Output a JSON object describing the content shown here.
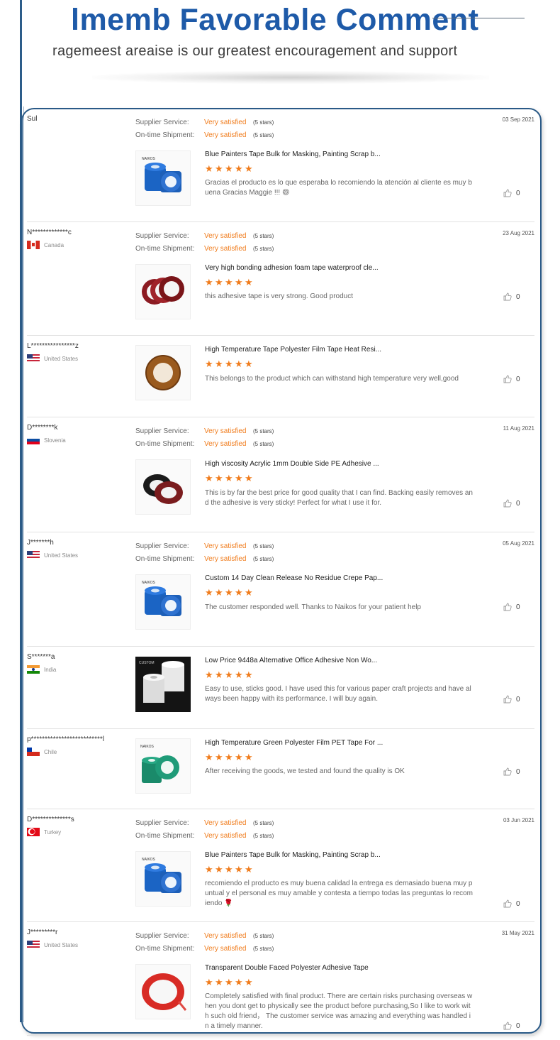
{
  "header": {
    "title": "lmemb Favorable Comment",
    "subtitle": "ragemeest areaise is our greatest encouragement and support"
  },
  "labels": {
    "supplier_service": "Supplier Service:",
    "shipment": "On-time Shipment:"
  },
  "reviews": [
    {
      "user": "Sul",
      "country": "",
      "date": "03 Sep 2021",
      "supplier_rating": "Very satisfied",
      "supplier_stars": "(5 stars)",
      "shipment_rating": "Very satisfied",
      "shipment_stars": "(5 stars)",
      "product": "Blue Painters Tape Bulk for Masking, Painting Scrap b...",
      "rating": 5,
      "comment": "Gracias el producto es lo que esperaba lo recomiendo la atención al cliente es muy buena Gracias Maggie !!! 😄",
      "likes": "0",
      "image": "blue-tape-icon"
    },
    {
      "user": "N*************c",
      "country": "Canada",
      "flag": "ca",
      "date": "23 Aug 2021",
      "supplier_rating": "Very satisfied",
      "supplier_stars": "(5 stars)",
      "shipment_rating": "Very satisfied",
      "shipment_stars": "(5 stars)",
      "product": "Very high bonding adhesion foam tape waterproof cle...",
      "rating": 5,
      "comment": "this adhesive tape is very strong. Good product",
      "likes": "0",
      "image": "red-tape-rolls-icon"
    },
    {
      "user": "L****************z",
      "country": "United States",
      "flag": "us",
      "date": "",
      "product": "High Temperature Tape Polyester Film Tape Heat Resi...",
      "rating": 5,
      "comment": "This belongs to the product which can withstand high temperature very well,good",
      "likes": "0",
      "image": "amber-tape-icon"
    },
    {
      "user": "D********k",
      "country": "Slovenia",
      "flag": "si",
      "date": "11 Aug 2021",
      "supplier_rating": "Very satisfied",
      "supplier_stars": "(5 stars)",
      "shipment_rating": "Very satisfied",
      "shipment_stars": "(5 stars)",
      "product": "High viscosity Acrylic 1mm Double Side PE Adhesive ...",
      "rating": 5,
      "comment": "This is by far the best price for good quality that I can find. Backing easily removes and the adhesive is very sticky! Perfect for what I use it for.",
      "likes": "0",
      "image": "black-foam-tape-icon"
    },
    {
      "user": "J*******h",
      "country": "United States",
      "flag": "us",
      "date": "05 Aug 2021",
      "supplier_rating": "Very satisfied",
      "supplier_stars": "(5 stars)",
      "shipment_rating": "Very satisfied",
      "shipment_stars": "(5 stars)",
      "product": "Custom 14 Day Clean Release No Residue Crepe Pap...",
      "rating": 5,
      "comment": "The customer responded well. Thanks to Naikos for your patient help",
      "likes": "0",
      "image": "blue-logo-tape-icon"
    },
    {
      "user": "S*******a",
      "country": "India",
      "flag": "in",
      "date": "",
      "product": "Low Price 9448a Alternative Office Adhesive Non Wo...",
      "rating": 5,
      "comment": "Easy to use, sticks good. I have used this for various paper craft projects and have always been happy with its performance. I will buy again.",
      "likes": "0",
      "image": "white-tape-rolls-icon"
    },
    {
      "user": "p**************************l",
      "country": "Chile",
      "flag": "cl",
      "date": "",
      "product": "High Temperature Green Polyester Film PET Tape For ...",
      "rating": 5,
      "comment": "After receiving the goods, we tested and found the quality is OK",
      "likes": "0",
      "image": "green-tape-icon"
    },
    {
      "user": "D**************s",
      "country": "Turkey",
      "flag": "tr",
      "date": "03 Jun 2021",
      "supplier_rating": "Very satisfied",
      "supplier_stars": "(5 stars)",
      "shipment_rating": "Very satisfied",
      "shipment_stars": "(5 stars)",
      "product": "Blue Painters Tape Bulk for Masking, Painting Scrap b...",
      "rating": 5,
      "comment": "recomiendo el producto es muy buena calidad la entrega es demasiado buena muy puntual y el personal es muy amable y contesta a tiempo todas las preguntas lo recomiendo 🌹",
      "likes": "0",
      "image": "blue-tape-icon"
    },
    {
      "user": "J*********r",
      "country": "United States",
      "flag": "us",
      "date": "31 May 2021",
      "supplier_rating": "Very satisfied",
      "supplier_stars": "(5 stars)",
      "shipment_rating": "Very satisfied",
      "shipment_stars": "(5 stars)",
      "product": "Transparent Double Faced Polyester Adhesive Tape",
      "rating": 5,
      "comment": "Completely satisfied with final product. There are certain risks purchasing overseas when you dont get to physically see the product before purchasing,So I like to work with such old friend， The customer service was amazing and everything was handled in a timely manner.",
      "likes": "0",
      "image": "red-clear-tape-icon"
    }
  ]
}
